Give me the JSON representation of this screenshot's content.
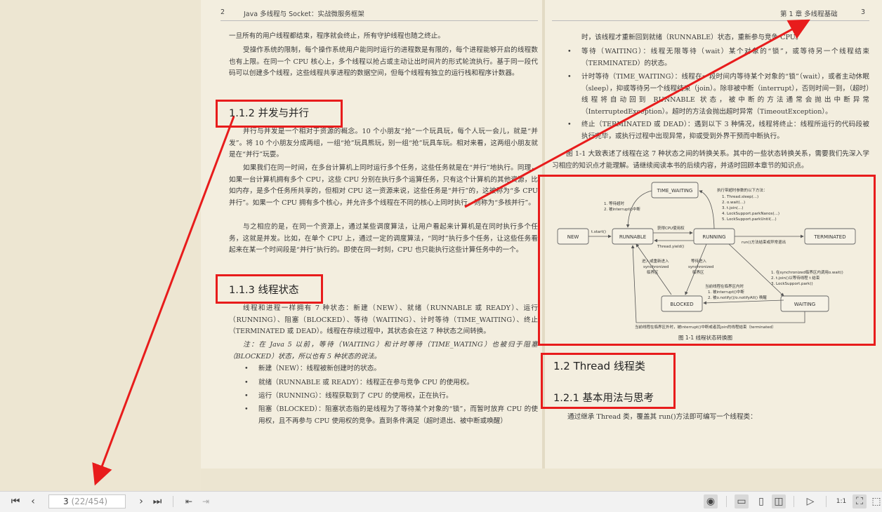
{
  "left_page": {
    "page_number": "2",
    "running_head": "Java 多线程与 Socket：实战微服务框架",
    "para1": "一旦所有的用户线程都结束，程序就会终止，所有守护线程也随之终止。",
    "para2": "受操作系统的限制，每个操作系统用户能同时运行的进程数是有限的，每个进程能够开启的线程数也有上限。在同一个 CPU 核心上，多个线程以抢占或主动让出时间片的形式轮流执行。基于同一段代码可以创建多个线程，这些线程共享进程的数据空间，但每个线程有独立的运行栈和程序计数器。",
    "sec_112": "1.1.2   并发与并行",
    "para3": "并行与并发是一个相对于资源的概念。10 个小朋友“抢”一个玩具玩，每个人玩一会儿，就是“并发”。将 10 个小朋友分成两组，一组“抢”玩具熊玩，别一组“抢”玩具车玩。相对来看，这两组小朋友就是在“并行”玩耍。",
    "para4": "如果我们在同一时间，在多台计算机上同时运行多个任务，这些任务就是在“并行”地执行。同理，如果一台计算机拥有多个 CPU，这些 CPU 分别在执行多个运算任务，只有这个计算机的其他资源，比如内存，是多个任务所共享的，但相对 CPU 这一资源来说，这些任务是“并行”的，这被称为“多 CPU 并行”。如果一个 CPU 拥有多个核心，并允许多个线程在不同的核心上同时执行，则称为“多核并行”。",
    "para5": "与之相应的是，在同一个资源上，通过某些调度算法，让用户看起来计算机是在同时执行多个任务，这就是并发。比如，在单个 CPU 上，通过一定的调度算法，“同时”执行多个任务，让这些任务看起来在某一个时间段是“并行”执行的。即使在同一时刻，CPU 也只能执行这些计算任务中的一个。",
    "sec_113": "1.1.3   线程状态",
    "para6": "线程和进程一样拥有 7 种状态：新建（NEW）、就绪（RUNNABLE 或 READY）、运行（RUNNING）、阻塞（BLOCKED）、等待（WAITING）、计时等待（TIME_WAITING）、终止（TERMINATED 或 DEAD）。线程在存续过程中，其状态会在这 7 种状态之间转换。",
    "note": "注：在 Java 5 以前，等待（WAITING）和计时等待（TIME_WATING）也被归于阻塞（BLOCKED）状态，所以也有 5 种状态的说法。",
    "bullets": [
      "新建（NEW）：线程被新创建时的状态。",
      "就绪（RUNNABLE 或 READY）：线程正在参与竞争 CPU 的使用权。",
      "运行（RUNNING）：线程获取到了 CPU 的使用权，正在执行。",
      "阻塞（BLOCKED）：阻塞状态指的是线程为了等待某个对象的“锁”，而暂时放弃 CPU 的使用权，且不再参与 CPU 使用权的竞争。直到条件满足（超时退出、被中断或唤醒）"
    ]
  },
  "right_page": {
    "page_number": "3",
    "running_head": "第 1 章   多线程基础",
    "cont_line": "时，该线程才重新回到就绪（RUNNABLE）状态，重新参与竞争 CPU。",
    "bullets": [
      "等待（WAITING）：线程无限等待（wait）某个对象的“锁”，或等待另一个线程结束（TERMINATED）的状态。",
      "计时等待（TIME_WAITING）：线程在一段时间内等待某个对象的“锁”（wait），或者主动休眠（sleep），抑或等待另一个线程结束（join）。除非被中断（interrupt），否则时间一到，（超时）线程将自动回到 RUNNABLE 状态，被中断的方法通常会抛出中断异常（InterruptedException）。超时的方法会抛出超时异常（TimeoutException）。",
      "终止（TERMINATED 或 DEAD）：遇到以下 3 种情况，线程将终止：线程所运行的代码段被执行完毕，或执行过程中出现异常，抑或受到外界干预而中断执行。"
    ],
    "para_fig": "图 1-1 大致表述了线程在这 7 种状态之间的转换关系。其中的一些状态转换关系，需要我们先深入学习相应的知识点才能理解。请继续阅读本书的后续内容，并适时回顾本章节的知识点。",
    "figure": {
      "states": [
        "TIME_WAITING",
        "NEW",
        "RUNNABLE",
        "RUNNING",
        "TERMINATED",
        "BLOCKED",
        "WAITING"
      ],
      "lbl_new_runnable": "t.start()",
      "lbl_get_cpu": "获得CPU使用权",
      "lbl_yield": "Thread.yield()",
      "lbl_run_end": "run()方法结束或异常退出",
      "lbl_tw_header": "执行带超时参数的以下方法：",
      "lbl_tw_list": [
        "1.  Thread.sleep(...)",
        "2.  o.wait(...)",
        "3.  t.join(...)",
        "4.  LockSupport.parkNanos(...)",
        "5.  LockSupport.parkUntil(...)"
      ],
      "lbl_tw_back": [
        "1.  等待超时",
        "2.  被interrupt()中断"
      ],
      "lbl_enter_sync_a": [
        "进入或重新进入",
        "synchronized",
        "临界区"
      ],
      "lbl_enter_sync_b": [
        "等待进入",
        "synchronized",
        "临界区"
      ],
      "lbl_wait_list": [
        "1.  在synchronized临界区内调用o.wait()",
        "2.  t.join()以等待线程 t 结束",
        "3.  LockSupport.park()"
      ],
      "lbl_notify": [
        "当前线程在临界区内时",
        "1.  被interrupt()中断",
        "2.  被o.notify()/o.notifyAll() 唤醒"
      ],
      "lbl_bottom": "当前线程在临界区外时，被interrupt()中断或者其join的线程结束（terminated）",
      "caption": "图 1-1   线程状态转换图"
    },
    "sec_12": "1.2   Thread 线程类",
    "sec_121": "1.2.1   基本用法与思考",
    "para_last": "通过继承 Thread 类，覆盖其 run()方法即可编写一个线程类："
  },
  "toolbar": {
    "page_current": "3",
    "page_total": "(22/454)",
    "icons": [
      "first-page-icon",
      "prev-page-icon",
      "next-page-icon",
      "last-page-icon",
      "back-icon",
      "forward-icon",
      "eye-care-icon",
      "continuous-view-icon",
      "single-page-icon",
      "two-page-icon",
      "play-icon",
      "actual-size-icon",
      "fit-page-icon",
      "select-icon"
    ]
  },
  "colors": {
    "annotation_red": "#e81c1c",
    "paper": "#f3eedf",
    "background": "#ede6d2"
  }
}
